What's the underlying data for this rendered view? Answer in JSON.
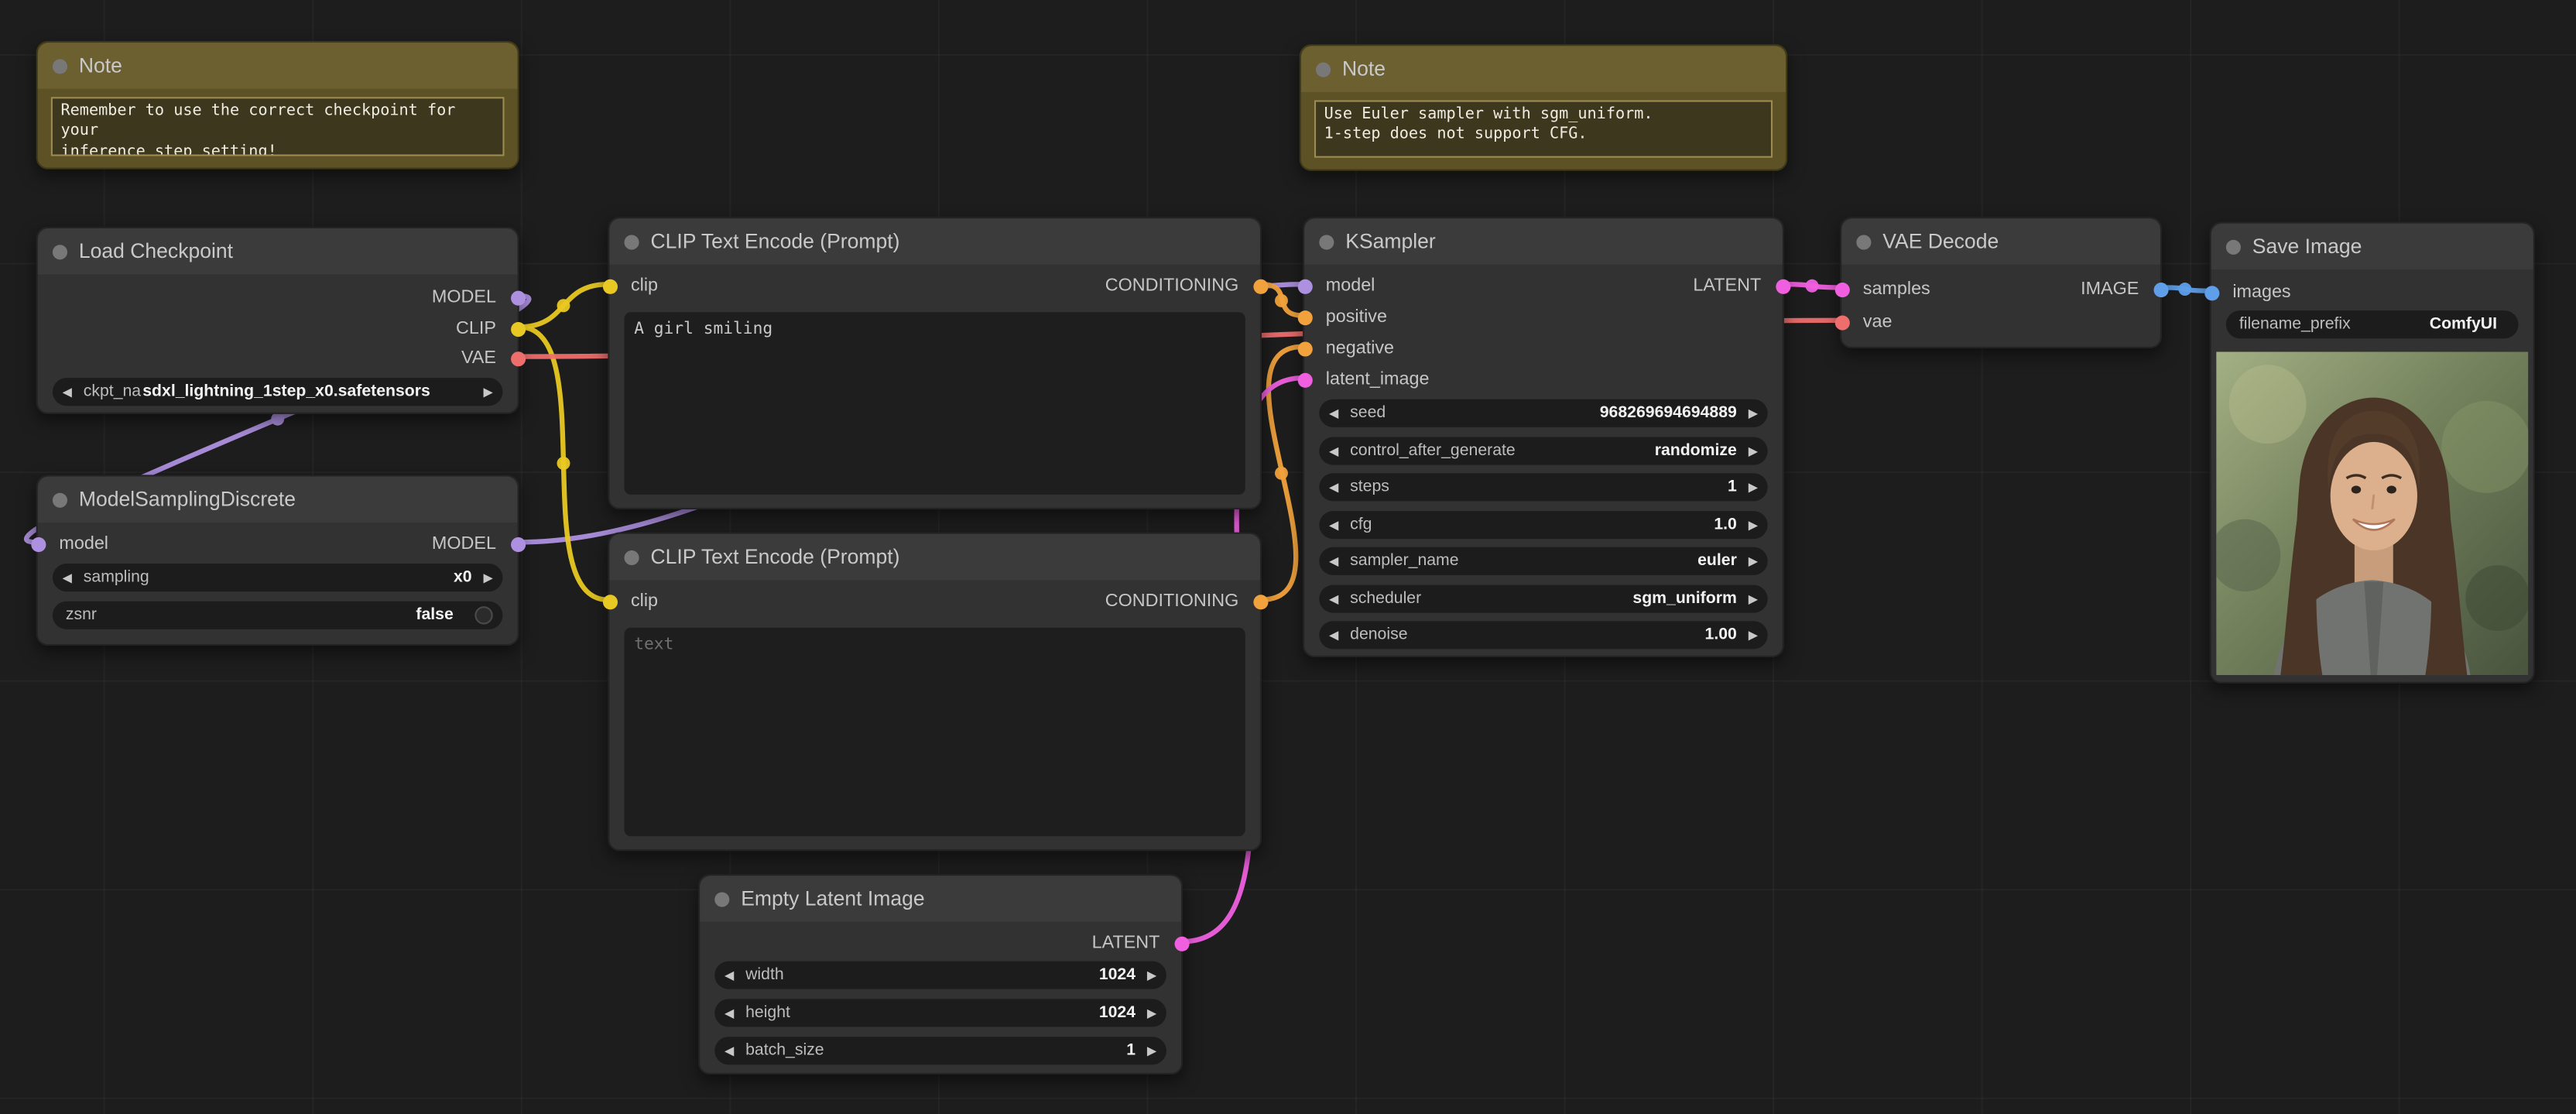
{
  "colors": {
    "model": "#ae90e0",
    "clip": "#e8c822",
    "vae": "#ee6e6e",
    "conditioning": "#f2a23c",
    "latent": "#ef5fdf",
    "image": "#5f9ee8"
  },
  "nodes": {
    "note_left": {
      "title": "Note",
      "line1": "Remember to use the correct checkpoint for your",
      "line2": "inference step setting!"
    },
    "note_right": {
      "title": "Note",
      "line1": "Use Euler sampler with sgm_uniform.",
      "line2": "1-step does not support CFG."
    },
    "load_checkpoint": {
      "title": "Load Checkpoint",
      "outputs": {
        "model": "MODEL",
        "clip": "CLIP",
        "vae": "VAE"
      },
      "ckpt_label": "ckpt_na",
      "ckpt_value": "sdxl_lightning_1step_x0.safetensors"
    },
    "model_sampling": {
      "title": "ModelSamplingDiscrete",
      "input_model": "model",
      "output_model": "MODEL",
      "widgets": [
        {
          "label": "sampling",
          "value": "x0"
        },
        {
          "label": "zsnr",
          "value": "false"
        }
      ]
    },
    "clip_positive": {
      "title": "CLIP Text Encode (Prompt)",
      "input_clip": "clip",
      "output_conditioning": "CONDITIONING",
      "text": "A girl smiling"
    },
    "clip_negative": {
      "title": "CLIP Text Encode (Prompt)",
      "input_clip": "clip",
      "output_conditioning": "CONDITIONING",
      "placeholder": "text"
    },
    "empty_latent": {
      "title": "Empty Latent Image",
      "output_latent": "LATENT",
      "widgets": [
        {
          "label": "width",
          "value": "1024"
        },
        {
          "label": "height",
          "value": "1024"
        },
        {
          "label": "batch_size",
          "value": "1"
        }
      ]
    },
    "ksampler": {
      "title": "KSampler",
      "inputs": [
        "model",
        "positive",
        "negative",
        "latent_image"
      ],
      "output_latent": "LATENT",
      "widgets": [
        {
          "label": "seed",
          "value": "968269694694889"
        },
        {
          "label": "control_after_generate",
          "value": "randomize"
        },
        {
          "label": "steps",
          "value": "1"
        },
        {
          "label": "cfg",
          "value": "1.0"
        },
        {
          "label": "sampler_name",
          "value": "euler"
        },
        {
          "label": "scheduler",
          "value": "sgm_uniform"
        },
        {
          "label": "denoise",
          "value": "1.00"
        }
      ]
    },
    "vae_decode": {
      "title": "VAE Decode",
      "input_samples": "samples",
      "input_vae": "vae",
      "output_image": "IMAGE"
    },
    "save_image": {
      "title": "Save Image",
      "input_images": "images",
      "prefix_label": "filename_prefix",
      "prefix_value": "ComfyUI"
    }
  }
}
